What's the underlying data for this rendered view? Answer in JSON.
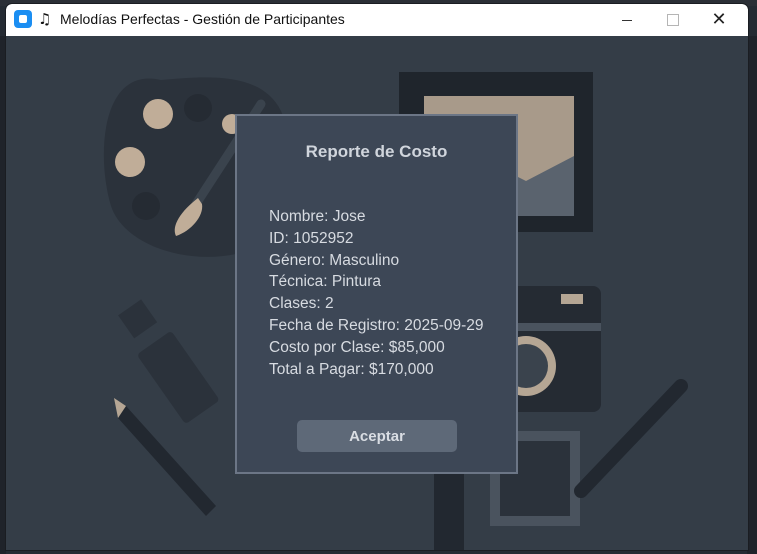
{
  "window": {
    "title": "Melodías Perfectas - Gestión de Participantes",
    "controls": [
      "minimize",
      "maximize",
      "close"
    ],
    "close_glyph": "✕"
  },
  "dialog": {
    "title": "Reporte de Costo",
    "lines": [
      "Nombre: Jose",
      "ID: 1052952",
      "Género: Masculino",
      "Técnica: Pintura",
      "Clases: 2",
      "Fecha de Registro: 2025-09-29",
      "Costo por Clase: $85,000",
      "Total a Pagar: $170,000"
    ],
    "accept_label": "Aceptar"
  },
  "icons": {
    "app": "app-window-icon",
    "music": "music-notes-icon"
  },
  "colors": {
    "background": "#343d47",
    "dialog_bg": "#3d4756",
    "dialog_border": "#6c7686",
    "button_bg": "#5e6978",
    "text": "#d7dbe1"
  }
}
